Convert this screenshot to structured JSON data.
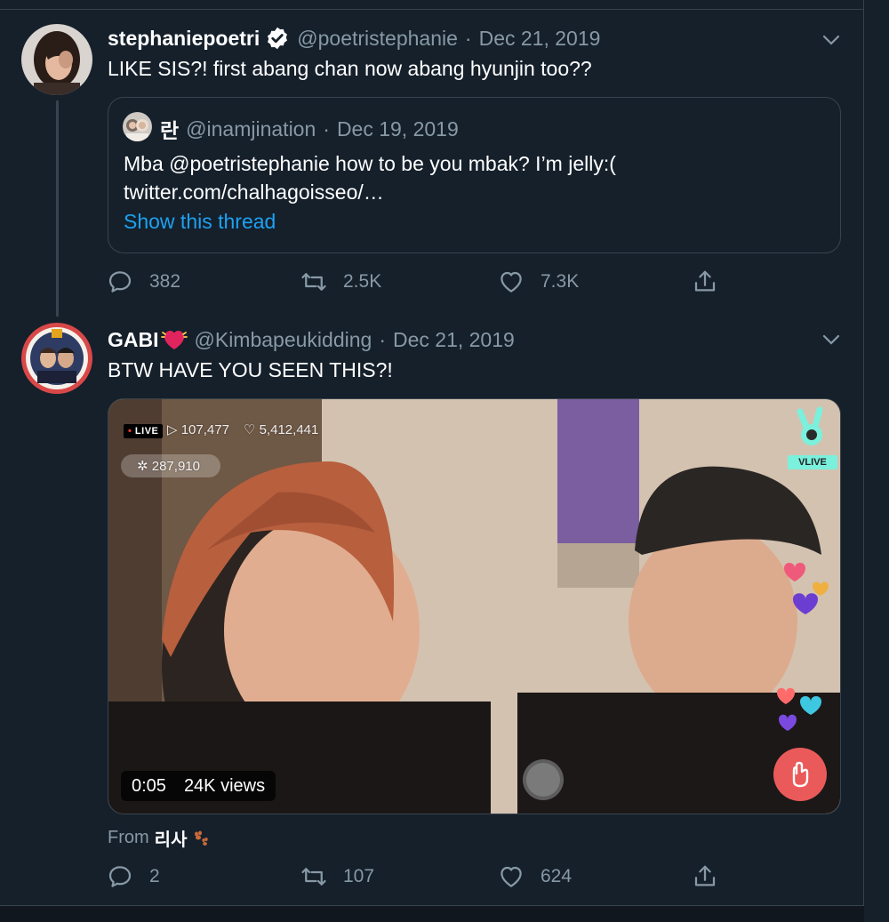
{
  "tweet1": {
    "display_name": "stephaniepoetri",
    "verified_icon": "verified-badge-icon",
    "handle": "@poetristephanie",
    "separator": "·",
    "date": "Dec 21, 2019",
    "text": "LIKE SIS?! first abang chan now abang hyunjin too??",
    "quote": {
      "display_name": "란",
      "handle": "@inamjination",
      "separator": "·",
      "date": "Dec 19, 2019",
      "text_line1": "Mba @poetristephanie how to be you mbak? I’m jelly:(",
      "text_line2": "twitter.com/chalhagoisseo/…",
      "show_thread": "Show this thread"
    },
    "actions": {
      "replies": "382",
      "retweets": "2.5K",
      "likes": "7.3K"
    }
  },
  "tweet2": {
    "display_name": "GABI",
    "name_emoji": "beating-heart-icon",
    "handle": "@Kimbapeukidding",
    "separator": "·",
    "date": "Dec 21, 2019",
    "text": "BTW HAVE YOU SEEN THIS?!",
    "video": {
      "live_label": "LIVE",
      "play_count": "▷ 107,477",
      "heart_count": "♡ 5,412,441",
      "sparkle_count": "287,910",
      "brand_label": "VLIVE",
      "elapsed": "0:05",
      "views": "24K views"
    },
    "from_prefix": "From",
    "from_name": "리사",
    "actions": {
      "replies": "2",
      "retweets": "107",
      "likes": "624"
    }
  },
  "colors": {
    "background": "#15202b",
    "secondary_text": "#8899a6",
    "link": "#1da1f2",
    "border": "#38444d"
  }
}
